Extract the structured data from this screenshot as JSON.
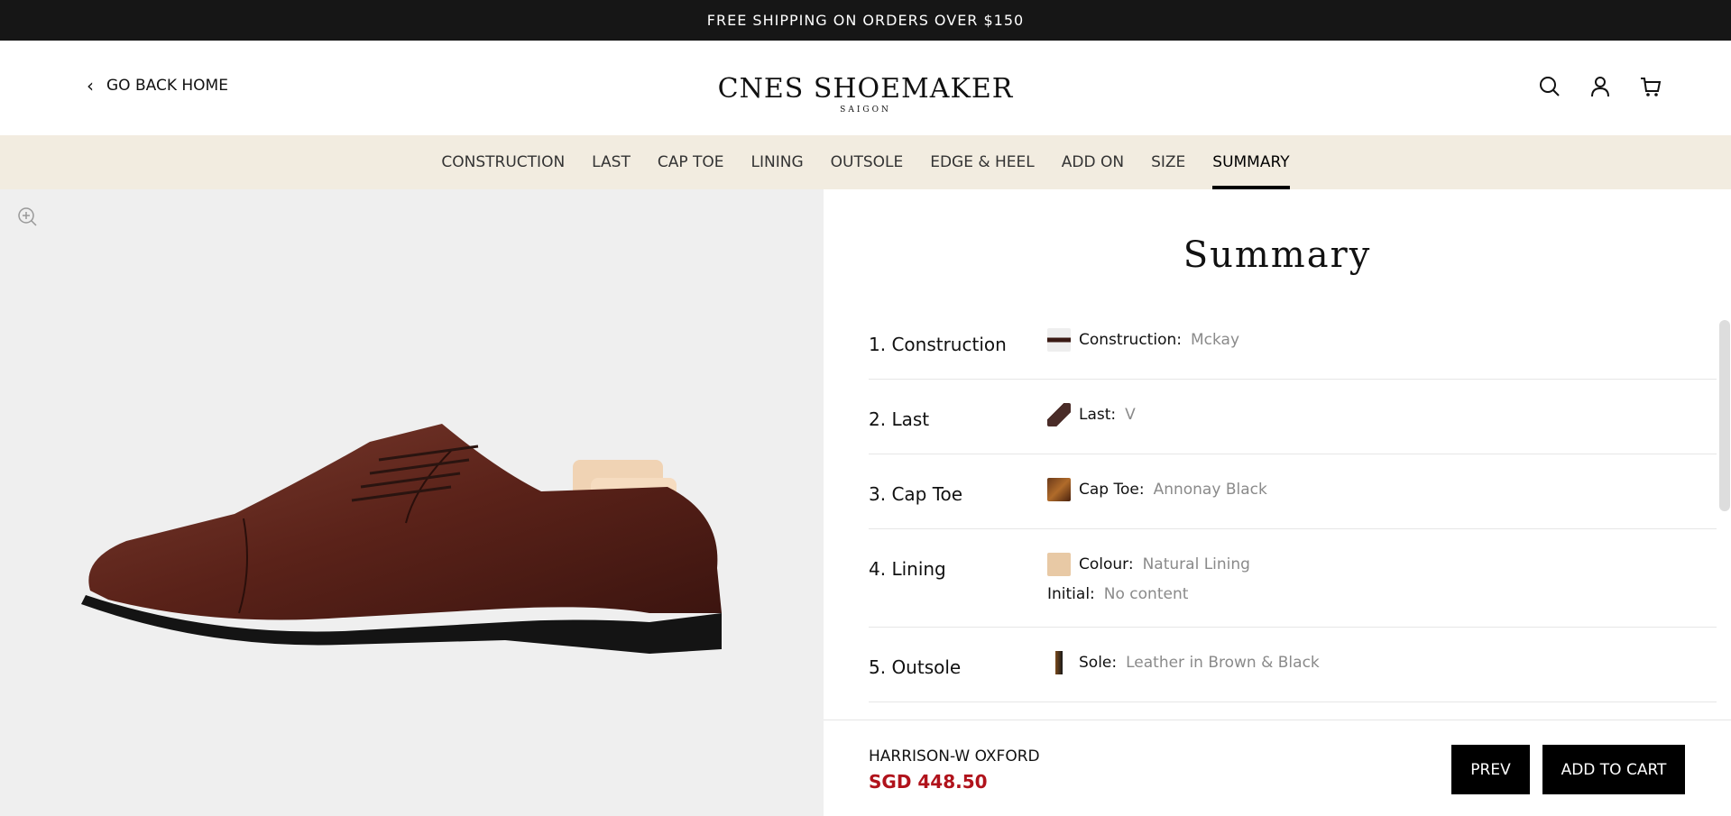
{
  "announcement": "FREE SHIPPING ON ORDERS OVER $150",
  "header": {
    "back_label": "GO BACK HOME",
    "brand": "CNES SHOEMAKER",
    "brand_sub": "SAIGON"
  },
  "tabs": [
    "CONSTRUCTION",
    "LAST",
    "CAP TOE",
    "LINING",
    "OUTSOLE",
    "EDGE & HEEL",
    "ADD ON",
    "SIZE",
    "SUMMARY"
  ],
  "active_tab": "SUMMARY",
  "summary": {
    "title": "Summary",
    "sections": [
      {
        "label": "1. Construction",
        "options": [
          {
            "key": "Construction:",
            "value": "Mckay"
          }
        ]
      },
      {
        "label": "2. Last",
        "options": [
          {
            "key": "Last:",
            "value": "V"
          }
        ]
      },
      {
        "label": "3. Cap Toe",
        "options": [
          {
            "key": "Cap Toe:",
            "value": "Annonay Black"
          }
        ]
      },
      {
        "label": "4. Lining",
        "options": [
          {
            "key": "Colour:",
            "value": "Natural Lining"
          },
          {
            "key": "Initial:",
            "value": "No content"
          }
        ]
      },
      {
        "label": "5. Outsole",
        "options": [
          {
            "key": "Sole:",
            "value": "Leather in Brown & Black"
          }
        ]
      }
    ]
  },
  "product": {
    "name": "HARRISON-W OXFORD",
    "price": "SGD 448.50"
  },
  "buttons": {
    "prev": "PREV",
    "add_to_cart": "ADD TO CART"
  },
  "colors": {
    "price": "#b0121b",
    "tab_bar": "#f2ece0",
    "announcement_bg": "#161616",
    "image_bg": "#efefef"
  }
}
